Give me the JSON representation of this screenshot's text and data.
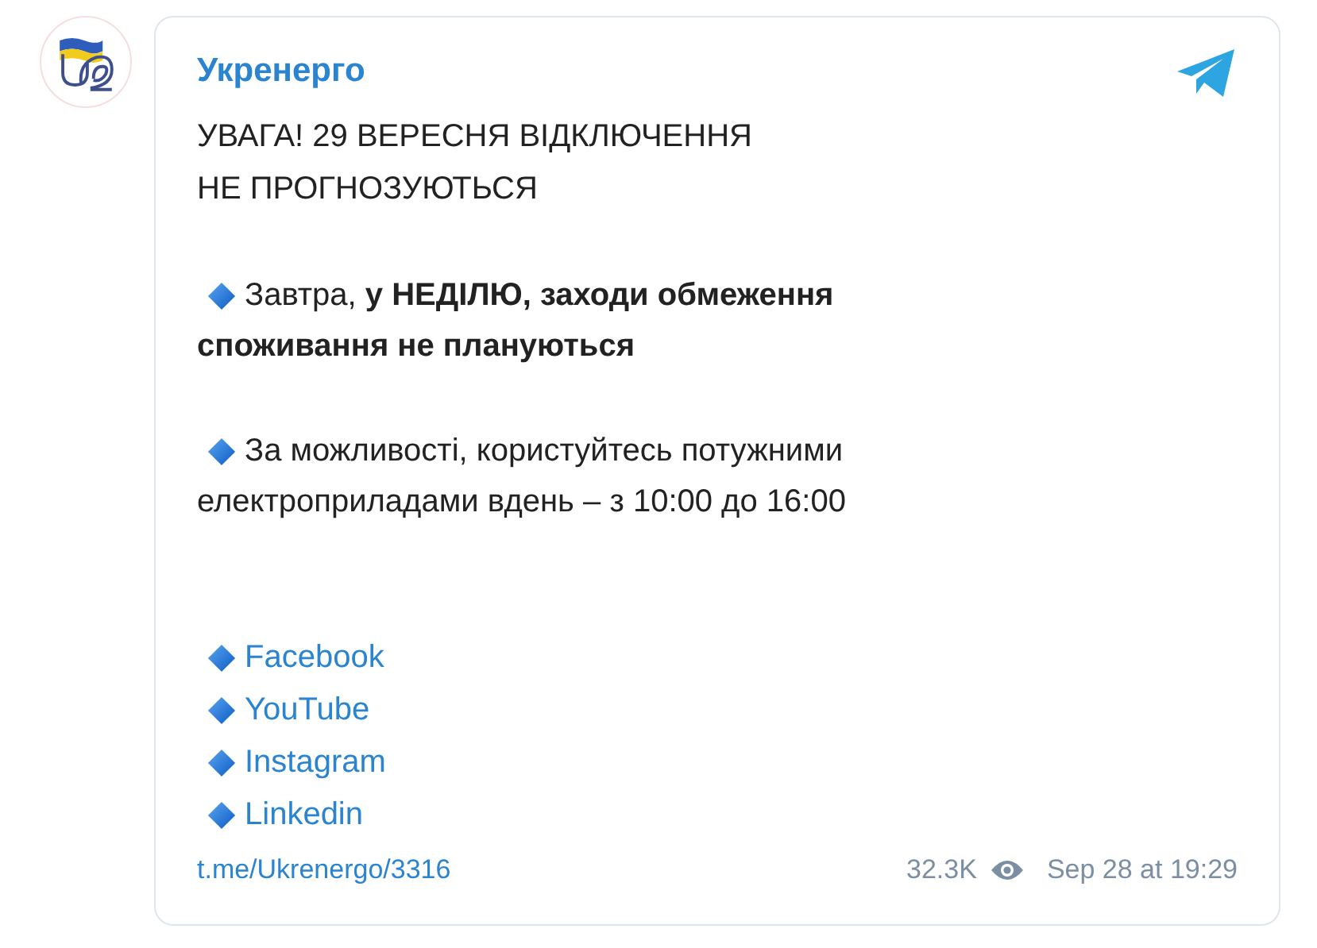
{
  "channel": {
    "name": "Укренерго"
  },
  "message": {
    "title_lines": [
      "УВАГА! 29 ВЕРЕСНЯ ВІДКЛЮЧЕННЯ",
      "НЕ ПРОГНОЗУЮТЬСЯ"
    ],
    "paragraphs": [
      [
        "Завтра, **у НЕДІЛЮ, заходи обмеження**",
        "**споживання не плануються**"
      ],
      [
        "За можливості, користуйтесь потужними",
        "електроприладами вдень – з 10:00 до 16:00"
      ]
    ],
    "links": [
      "Facebook",
      "YouTube",
      "Instagram",
      "Linkedin"
    ],
    "post_link": "t.me/Ukrenergo/3316",
    "views": "32.3K",
    "date": "Sep 28 at 19:29"
  }
}
